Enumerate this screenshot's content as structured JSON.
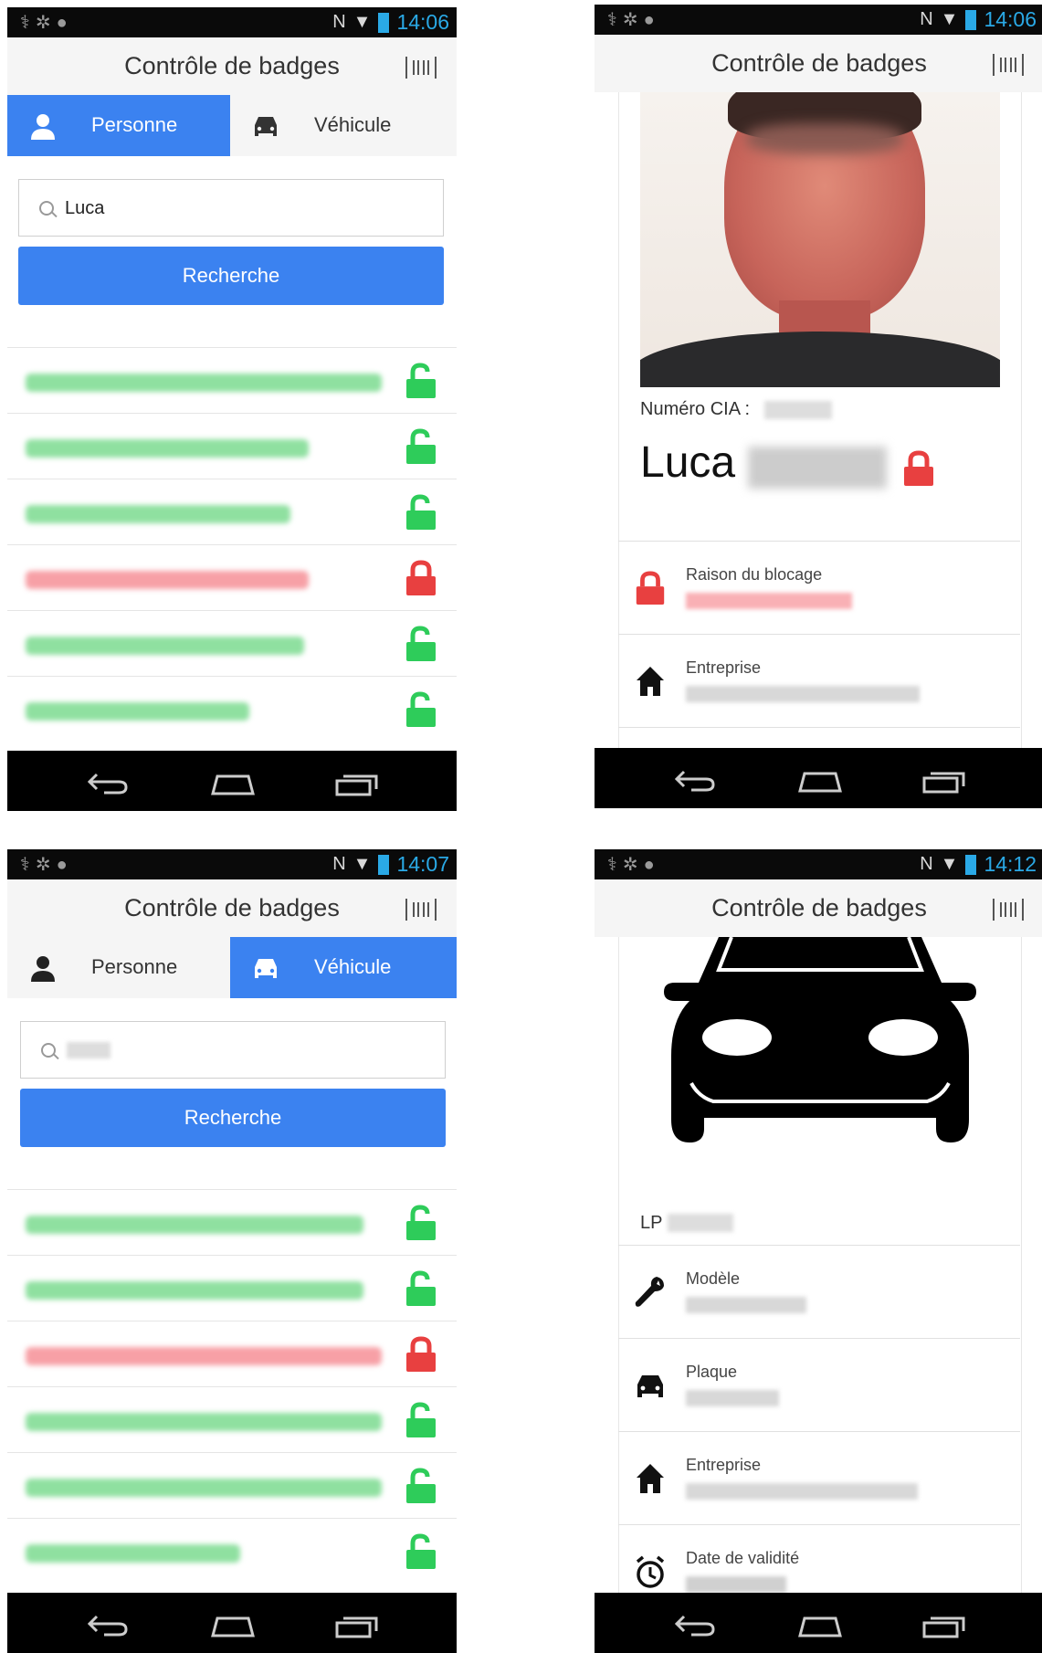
{
  "status_bar": {
    "screen1_time": "14:06",
    "screen2_time": "14:06",
    "screen3_time": "14:07",
    "screen4_time": "14:12"
  },
  "app": {
    "title": "Contrôle de badges"
  },
  "tabs": {
    "person": "Personne",
    "vehicle": "Véhicule"
  },
  "search": {
    "person_query": "Luca",
    "button": "Recherche"
  },
  "results_person": [
    {
      "status": "unlocked"
    },
    {
      "status": "unlocked"
    },
    {
      "status": "unlocked"
    },
    {
      "status": "locked"
    },
    {
      "status": "unlocked"
    },
    {
      "status": "unlocked"
    }
  ],
  "results_vehicle": [
    {
      "status": "unlocked"
    },
    {
      "status": "unlocked"
    },
    {
      "status": "locked"
    },
    {
      "status": "unlocked"
    },
    {
      "status": "unlocked"
    },
    {
      "status": "unlocked"
    }
  ],
  "person_detail": {
    "cia_label": "Numéro CIA :",
    "first_name": "Luca",
    "block_reason_label": "Raison du blocage",
    "company_label": "Entreprise"
  },
  "vehicle_detail": {
    "lp_label": "LP",
    "model_label": "Modèle",
    "plate_label": "Plaque",
    "company_label": "Entreprise",
    "validity_label": "Date de validité"
  },
  "colors": {
    "accent": "#3b82f0",
    "unlocked": "#2ecc5a",
    "locked": "#e84040"
  },
  "icons": [
    "person-icon",
    "car-icon",
    "search-icon",
    "lock-open-icon",
    "lock-closed-icon",
    "barcode-scan-icon",
    "back-icon",
    "home-icon",
    "recents-icon",
    "house-icon",
    "wrench-icon",
    "clock-icon"
  ]
}
